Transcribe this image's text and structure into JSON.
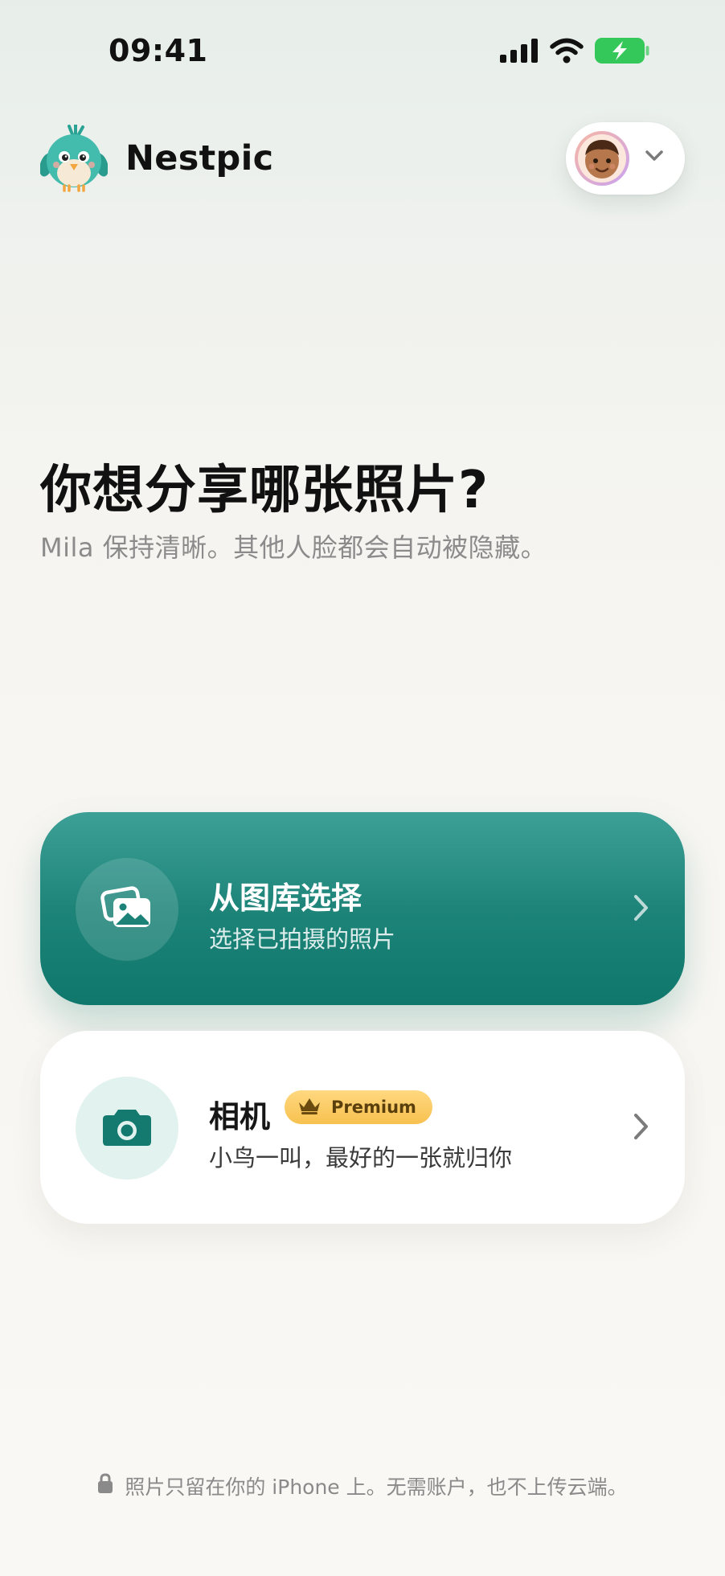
{
  "status_bar": {
    "time": "09:41",
    "icons": [
      "cellular-signal-icon",
      "wifi-icon",
      "battery-charging-icon"
    ],
    "battery_color": "#34c759"
  },
  "header": {
    "app_name": "Nestpic",
    "logo_icon": "bird-mascot-logo",
    "profile": {
      "avatar_icon": "child-avatar-icon",
      "dropdown_icon": "chevron-down-icon"
    }
  },
  "hero": {
    "title": "你想分享哪张照片?",
    "subtitle": "Mila 保持清晰。其他人脸都会自动被隐藏。"
  },
  "options": {
    "gallery": {
      "title": "从图库选择",
      "subtitle": "选择已拍摄的照片",
      "icon": "photo-stack-icon",
      "accent": "#157d72"
    },
    "camera": {
      "title": "相机",
      "badge": "Premium",
      "badge_icon": "crown-icon",
      "subtitle": "小鸟一叫，最好的一张就归你",
      "icon": "camera-icon"
    }
  },
  "footer": {
    "note": "照片只留在你的 iPhone 上。无需账户，也不上传云端。",
    "icon": "lock-icon"
  }
}
